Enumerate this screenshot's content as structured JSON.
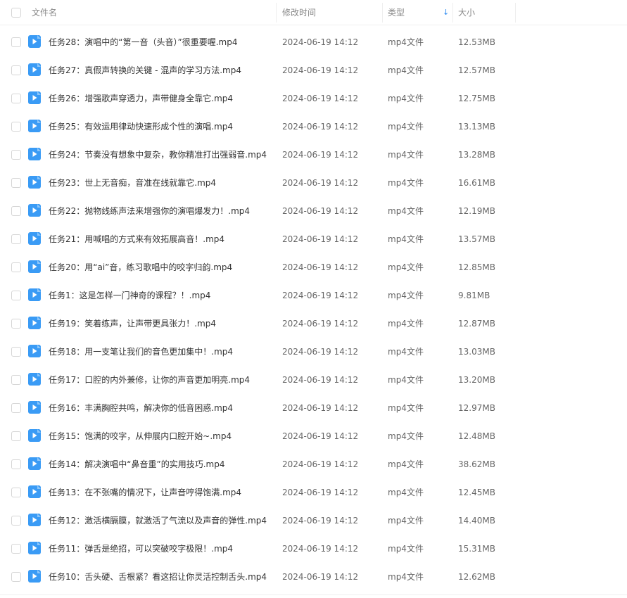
{
  "colors": {
    "accent": "#2f8cf0",
    "file_icon": "#3a9bf5"
  },
  "header": {
    "name_label": "文件名",
    "time_label": "修改时间",
    "type_label": "类型",
    "size_label": "大小",
    "sort_icon": "sort-arrow-down-icon"
  },
  "rows": [
    {
      "name": "任务28：演唱中的“第一音（头音）”很重要喔.mp4",
      "time": "2024-06-19 14:12",
      "type": "mp4文件",
      "size": "12.53MB"
    },
    {
      "name": "任务27：真假声转换的关键 - 混声的学习方法.mp4",
      "time": "2024-06-19 14:12",
      "type": "mp4文件",
      "size": "12.57MB"
    },
    {
      "name": "任务26：增强歌声穿透力，声带健身全靠它.mp4",
      "time": "2024-06-19 14:12",
      "type": "mp4文件",
      "size": "12.75MB"
    },
    {
      "name": "任务25：有效运用律动快速形成个性的演唱.mp4",
      "time": "2024-06-19 14:12",
      "type": "mp4文件",
      "size": "13.13MB"
    },
    {
      "name": "任务24：节奏没有想象中复杂，教你精准打出强弱音.mp4",
      "time": "2024-06-19 14:12",
      "type": "mp4文件",
      "size": "13.28MB"
    },
    {
      "name": "任务23：世上无音痴，音准在线就靠它.mp4",
      "time": "2024-06-19 14:12",
      "type": "mp4文件",
      "size": "16.61MB"
    },
    {
      "name": "任务22：抛物线练声法来增强你的演唱爆发力！.mp4",
      "time": "2024-06-19 14:12",
      "type": "mp4文件",
      "size": "12.19MB"
    },
    {
      "name": "任务21：用喊唱的方式来有效拓展高音！.mp4",
      "time": "2024-06-19 14:12",
      "type": "mp4文件",
      "size": "13.57MB"
    },
    {
      "name": "任务20：用“ai”音，练习歌唱中的咬字归韵.mp4",
      "time": "2024-06-19 14:12",
      "type": "mp4文件",
      "size": "12.85MB"
    },
    {
      "name": "任务1：这是怎样一门神奇的课程？！.mp4",
      "time": "2024-06-19 14:12",
      "type": "mp4文件",
      "size": "9.81MB"
    },
    {
      "name": "任务19：笑着练声，让声带更具张力！.mp4",
      "time": "2024-06-19 14:12",
      "type": "mp4文件",
      "size": "12.87MB"
    },
    {
      "name": "任务18：用一支笔让我们的音色更加集中！.mp4",
      "time": "2024-06-19 14:12",
      "type": "mp4文件",
      "size": "13.03MB"
    },
    {
      "name": "任务17：口腔的内外兼修，让你的声音更加明亮.mp4",
      "time": "2024-06-19 14:12",
      "type": "mp4文件",
      "size": "13.20MB"
    },
    {
      "name": "任务16：丰满胸腔共鸣，解决你的低音困惑.mp4",
      "time": "2024-06-19 14:12",
      "type": "mp4文件",
      "size": "12.97MB"
    },
    {
      "name": "任务15：饱满的咬字，从伸展内口腔开始~.mp4",
      "time": "2024-06-19 14:12",
      "type": "mp4文件",
      "size": "12.48MB"
    },
    {
      "name": "任务14：解决演唱中“鼻音重”的实用技巧.mp4",
      "time": "2024-06-19 14:12",
      "type": "mp4文件",
      "size": "38.62MB"
    },
    {
      "name": "任务13：在不张嘴的情况下，让声音哼得饱满.mp4",
      "time": "2024-06-19 14:12",
      "type": "mp4文件",
      "size": "12.45MB"
    },
    {
      "name": "任务12：激活横膈膜，就激活了气流以及声音的弹性.mp4",
      "time": "2024-06-19 14:12",
      "type": "mp4文件",
      "size": "14.40MB"
    },
    {
      "name": "任务11：弹舌是绝招，可以突破咬字极限！.mp4",
      "time": "2024-06-19 14:12",
      "type": "mp4文件",
      "size": "15.31MB"
    },
    {
      "name": "任务10：舌头硬、舌根紧？看这招让你灵活控制舌头.mp4",
      "time": "2024-06-19 14:12",
      "type": "mp4文件",
      "size": "12.62MB"
    }
  ]
}
